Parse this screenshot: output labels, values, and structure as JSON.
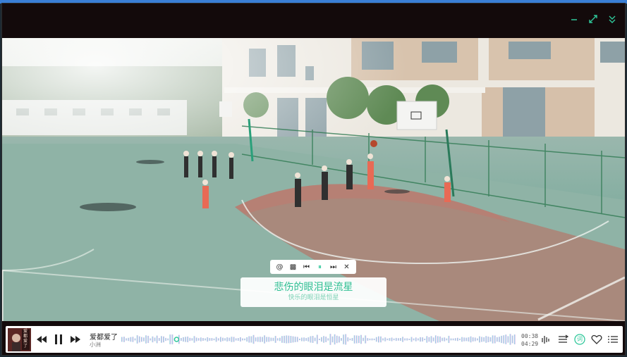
{
  "window": {
    "minimize_glyph": "–",
    "accent": "#2fc79a"
  },
  "lyric_toolbar": {
    "items": [
      "@",
      "▩",
      "⏮",
      "⏸",
      "⏭",
      "✕"
    ]
  },
  "lyrics": {
    "current": "悲伤的眼泪是流星",
    "next": "快乐的眼泪是恒星"
  },
  "player": {
    "song_title": "爱都爱了",
    "artist": "小洲",
    "elapsed": "00:38",
    "duration": "04:29",
    "progress": 0.14,
    "lyrics_toggle_label": "词",
    "cover_text": "爱都爱了"
  }
}
